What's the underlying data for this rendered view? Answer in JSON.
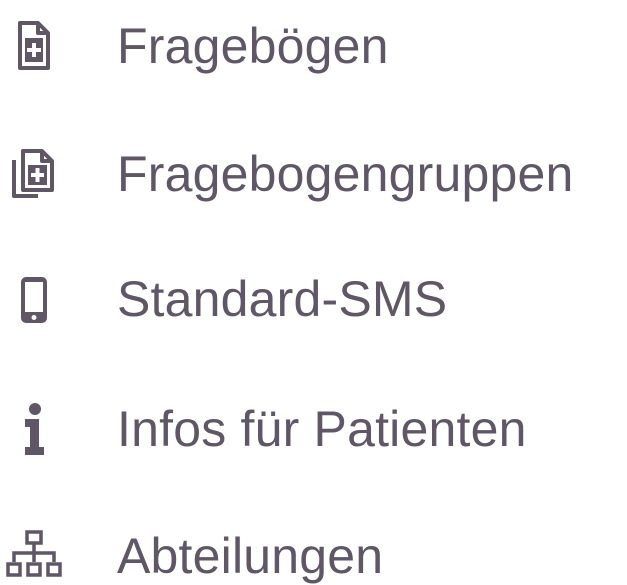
{
  "colors": {
    "text": "#5f5666",
    "icon": "#5f5666",
    "background": "#ffffff"
  },
  "menu": {
    "items": [
      {
        "label": "Fragebögen",
        "icon": "file-plus-icon"
      },
      {
        "label": "Fragebogengruppen",
        "icon": "files-plus-icon"
      },
      {
        "label": "Standard-SMS",
        "icon": "mobile-phone-icon"
      },
      {
        "label": "Infos für Patienten",
        "icon": "info-icon"
      },
      {
        "label": "Abteilungen",
        "icon": "sitemap-icon"
      }
    ]
  }
}
